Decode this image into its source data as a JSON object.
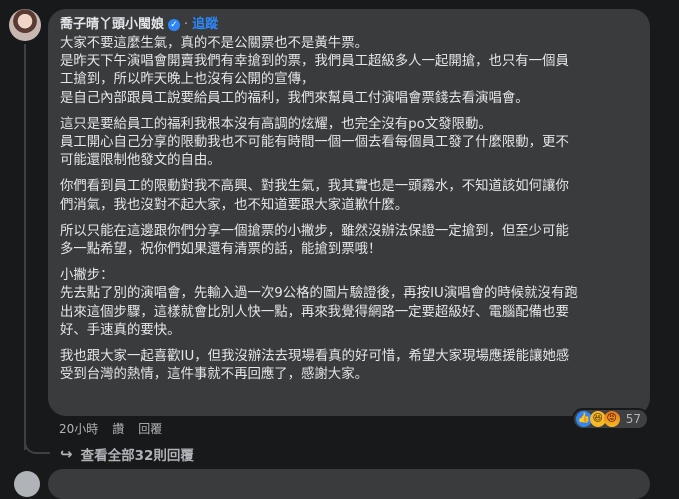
{
  "comment": {
    "author": "喬子晴丫頭小閩娘",
    "verified_mark": "✓",
    "separator": "·",
    "follow_label": "追蹤",
    "paragraphs": [
      "大家不要這麼生氣，真的不是公關票也不是黃牛票。\n是昨天下午演唱會開賣我們有幸搶到的票，我們員工超級多人一起開搶，也只有一個員\n工搶到，所以昨天晚上也沒有公開的宣傳，\n是自己內部跟員工說要給員工的福利，我們來幫員工付演唱會票錢去看演唱會。",
      "這只是要給員工的福利我根本沒有高調的炫耀，也完全沒有po文發限動。\n員工開心自己分享的限動我也不可能有時間一個一個去看每個員工發了什麼限動，更不\n可能還限制他發文的自由。",
      "你們看到員工的限動對我不高興、對我生氣，我其實也是一頭霧水，不知道該如何讓你\n們消氣，我也沒對不起大家，也不知道要跟大家道歉什麼。",
      "所以只能在這邊跟你們分享一個搶票的小撇步，雖然沒辦法保證一定搶到，但至少可能\n多一點希望，祝你們如果還有清票的話，能搶到票哦！",
      "小撇步：\n先去點了別的演唱會，先輸入過一次9公格的圖片驗證後，再按IU演唱會的時候就沒有跑\n出來這個步驟，這樣就會比別人快一點，再來我覺得網路一定要超級好、電腦配備也要\n好、手速真的要快。",
      "我也跟大家一起喜歡IU，但我沒辦法去現場看真的好可惜，希望大家現場應援能讓她感\n受到台灣的熱情，這件事就不再回應了，感謝大家。"
    ],
    "reactions": {
      "like_icon": "👍",
      "haha_icon": "😆",
      "angry_icon": "😡",
      "count": "57"
    },
    "meta": {
      "time": "20小時",
      "like_label": "讚",
      "reply_label": "回覆"
    },
    "view_replies": {
      "arrow_icon": "↪",
      "label": "查看全部32則回覆"
    }
  }
}
